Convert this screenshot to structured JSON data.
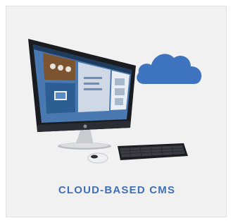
{
  "card": {
    "caption": "CLOUD-BASED CMS",
    "caption_color": "#3f6fb5",
    "icon": "computer-with-cloud-illustration"
  },
  "cloud": {
    "icon": "cloud-icon",
    "color": "#3d73bf"
  },
  "monitor": {
    "icon": "all-in-one-desktop-icon",
    "screen_tiles": [
      "tile-people",
      "tile-video",
      "tile-info",
      "tile-photos"
    ]
  }
}
